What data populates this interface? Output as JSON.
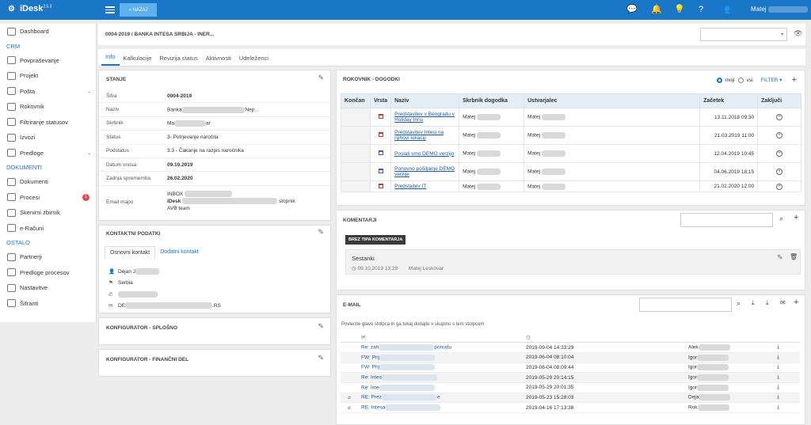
{
  "app": {
    "name": "iDesk",
    "version": "2.5.3",
    "back_label": "« NAZAJ",
    "user": "Matej"
  },
  "sidebar": {
    "items": [
      {
        "label": "Dashboard",
        "type": "item"
      },
      {
        "label": "CRM",
        "type": "section"
      },
      {
        "label": "Povpraševanje",
        "type": "item"
      },
      {
        "label": "Projekt",
        "type": "item"
      },
      {
        "label": "Pošta",
        "type": "item",
        "chevron": true
      },
      {
        "label": "Rokovnik",
        "type": "item"
      },
      {
        "label": "Filtriranje statusov",
        "type": "item"
      },
      {
        "label": "Izvozi",
        "type": "item"
      },
      {
        "label": "Predloge",
        "type": "item",
        "chevron": true
      },
      {
        "label": "DOKUMENTI",
        "type": "section"
      },
      {
        "label": "Dokumenti",
        "type": "item"
      },
      {
        "label": "Procesi",
        "type": "item",
        "badge": "1"
      },
      {
        "label": "Skenirni zbirnik",
        "type": "item"
      },
      {
        "label": "e-Računi",
        "type": "item"
      },
      {
        "label": "OSTALO",
        "type": "section"
      },
      {
        "label": "Partnerji",
        "type": "item"
      },
      {
        "label": "Predloge procesov",
        "type": "item"
      },
      {
        "label": "Nastavitve",
        "type": "item"
      },
      {
        "label": "Šifranti",
        "type": "item"
      }
    ]
  },
  "breadcrumb": "0004-2019 / BANKA INTESA SRBIJA - INER...",
  "tabs": [
    "Info",
    "Kalkulacije",
    "Revizija status",
    "Aktivnosti",
    "Udeleženci"
  ],
  "stanje": {
    "title": "STANJE",
    "rows": [
      {
        "k": "Šifra",
        "v": "0004-2019",
        "b": true
      },
      {
        "k": "Naziv",
        "v": "Banka",
        "v2": "Nep...",
        "b": false
      },
      {
        "k": "Skrbnik",
        "v": "Ma",
        "v2": "ar",
        "b": false
      },
      {
        "k": "Status",
        "v": "3- Potrjevanje naročila",
        "b": false
      },
      {
        "k": "Podstatus",
        "v": "3.3 - Čakanje na razpis naročnika",
        "b": false
      },
      {
        "k": "Datum vnosa",
        "v": "09.10.2019",
        "b": true
      },
      {
        "k": "Zadnja sprememba",
        "v": "26.02.2020",
        "b": true
      }
    ],
    "email_label": "Email mapo",
    "email_lines": [
      "INBOX",
      "iDesk",
      "AVB team"
    ],
    "email_tail": "stopnik"
  },
  "kontakt": {
    "title": "KONTAKTNI PODATKI",
    "tab1": "Osnovni kontakt",
    "tab2": "Dodatni kontakt",
    "name": "Dejan J",
    "country": "Serbia",
    "email_start": "DE",
    "email_end": ".RS"
  },
  "konf1": "KONFIGURATOR - SPLOŠNO",
  "konf2": "KONFIGURATOR - FINANČNI DEL",
  "rokovnik": {
    "title": "ROKOVNIK - DOGODKI",
    "radio_moji": "moji",
    "radio_vsi": "vsi",
    "filter": "FILTER",
    "headers": [
      "Končan",
      "Vrsta",
      "Naziv",
      "Skrbnik dogodka",
      "Ustvarjalec",
      "Začetek",
      "Zaključi"
    ],
    "rows": [
      {
        "naziv": "Predstavitev v Beogradu v Holiday Innu",
        "skrbnik": "Matej",
        "ustvarjalec": "Matej",
        "zacetek": "13.11.2018 09:30",
        "color": "red"
      },
      {
        "naziv": "Predstavitev Intesi na njihovi lokaciji",
        "skrbnik": "Matej",
        "ustvarjalec": "Matej",
        "zacetek": "21.03.2019 11:00",
        "color": "red"
      },
      {
        "naziv": "Poslali smo DEMO verzijo",
        "skrbnik": "Matej",
        "ustvarjalec": "Matej",
        "zacetek": "12.04.2019 10:45",
        "color": "blue"
      },
      {
        "naziv": "Ponovno pošiljanje DEMO verzije",
        "skrbnik": "Matej",
        "ustvarjalec": "Matej",
        "zacetek": "04.06.2019 18:15",
        "color": "blue"
      },
      {
        "naziv": "Predstaitev IT",
        "skrbnik": "Matej",
        "ustvarjalec": "Matej",
        "zacetek": "21.02.2020 12:00",
        "color": "red"
      }
    ]
  },
  "komentarji": {
    "title": "KOMENTARJI",
    "tag": "BREZ TIPA KOMENTARJA",
    "comment_title": "Sestanki",
    "comment_date": "09.10.2019 13:28",
    "comment_author": "Matej Leskovar"
  },
  "email": {
    "title": "E-MAIL",
    "hint": "Povlecite glavo stolpca in ga tukaj dodajte v skupino s tem stolpcem",
    "rows": [
      {
        "subj": "Re: zah",
        "subj2": "ponudu",
        "date": "2019-09-04 14:33:29",
        "from": "Alek",
        "attach": false
      },
      {
        "subj": "FW: Prij",
        "subj2": "",
        "date": "2019-06-04 08:10:04",
        "from": "Igor",
        "attach": false
      },
      {
        "subj": "FW: Prij",
        "subj2": "",
        "date": "2019-06-04 08:09:44",
        "from": "Igor",
        "attach": false
      },
      {
        "subj": "Re: Intes",
        "subj2": "",
        "date": "2019-05-29 20:14:15",
        "from": "Igor",
        "attach": false
      },
      {
        "subj": "Re: Inte",
        "subj2": "",
        "date": "2019-05-29 20:01:35",
        "from": "Igor",
        "attach": false
      },
      {
        "subj": "RE: Prez",
        "subj2": "e",
        "date": "2019-05-23 15:28:03",
        "from": "Deja",
        "attach": true
      },
      {
        "subj": "RE: Intesa",
        "subj2": "",
        "date": "2019-04-16 17:13:38",
        "from": "Rok",
        "attach": true
      }
    ]
  }
}
